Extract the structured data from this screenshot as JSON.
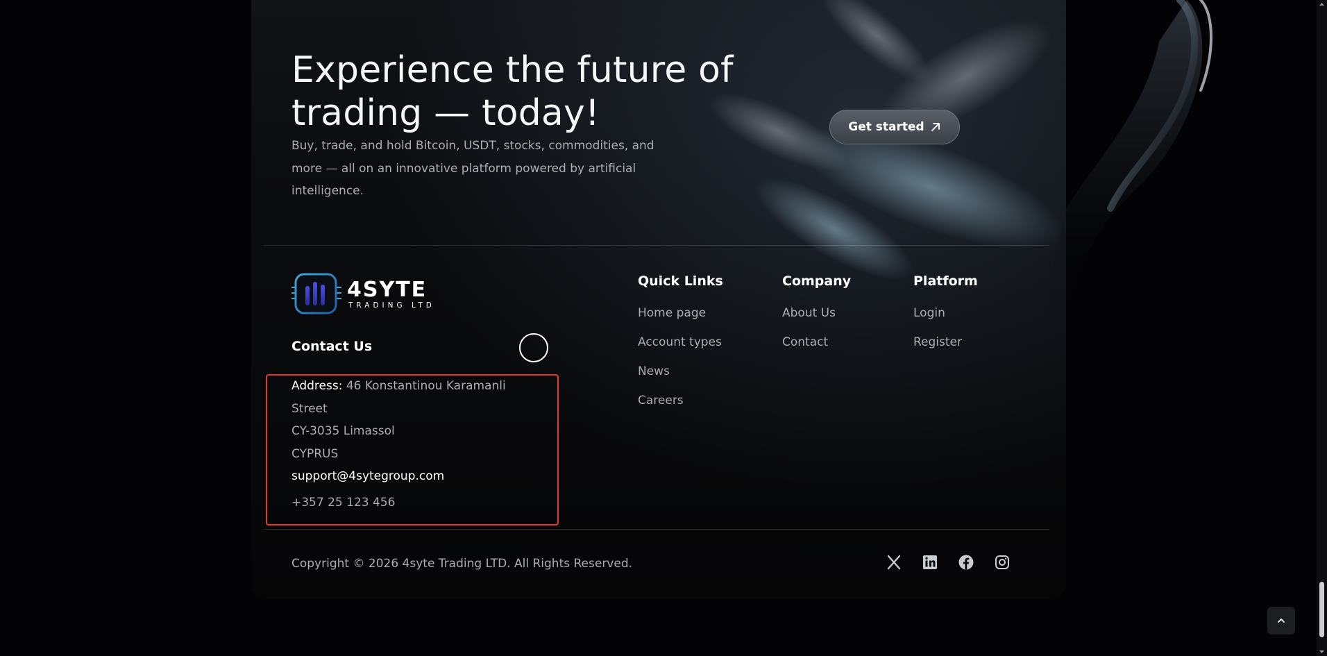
{
  "hero": {
    "title": "Experience the future of trading — today!",
    "subtitle": "Buy, trade, and hold Bitcoin, USDT, stocks, commodities, and more — all on an innovative platform powered by artificial intelligence.",
    "cta_label": "Get started",
    "cta_icon": "arrow-up-right-icon"
  },
  "brand": {
    "name": "4SYTE",
    "tagline": "TRADING LTD"
  },
  "contact": {
    "title": "Contact Us",
    "address_label": "Address:",
    "address_line1": "46 Konstantinou Karamanli Street",
    "address_line2": "CY-3035 Limassol",
    "address_line3": "CYPRUS",
    "email": "support@4sytegroup.com",
    "phone": "+357 25 123 456"
  },
  "columns": [
    {
      "title": "Quick Links",
      "links": [
        "Home page",
        "Account types",
        "News",
        "Careers"
      ]
    },
    {
      "title": "Company",
      "links": [
        "About Us",
        "Contact"
      ]
    },
    {
      "title": "Platform",
      "links": [
        "Login",
        "Register"
      ]
    }
  ],
  "footer": {
    "copyright": "Copyright © 2026 4syte Trading LTD. All Rights Reserved.",
    "socials": [
      "x-icon",
      "linkedin-icon",
      "facebook-icon",
      "instagram-icon"
    ]
  },
  "colors": {
    "highlight": "#e2392c",
    "muted_text": "#a9adb4",
    "logo_accent": "#3fa9d6"
  }
}
